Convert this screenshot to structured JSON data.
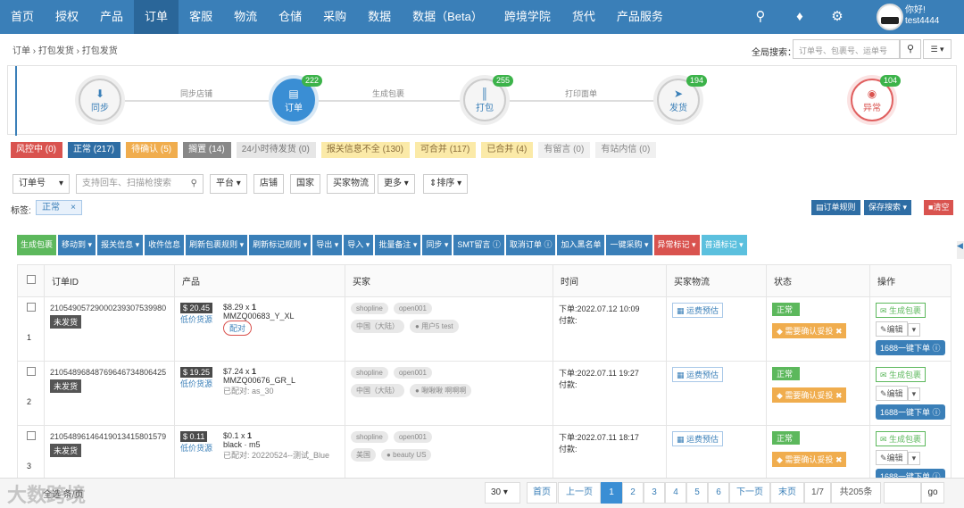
{
  "nav": {
    "items": [
      "首页",
      "授权",
      "产品",
      "订单",
      "客服",
      "物流",
      "仓储",
      "采购",
      "数据",
      "数据（Beta）",
      "跨境学院",
      "货代",
      "产品服务"
    ],
    "active": "订单",
    "user_greeting": "你好!",
    "username": "test4444"
  },
  "breadcrumb": [
    "订单",
    "打包发货",
    "打包发货"
  ],
  "global_search": {
    "label": "全局搜索：",
    "placeholder": "订单号、包裹号、运单号"
  },
  "steps": [
    {
      "label": "同步",
      "badge": ""
    },
    {
      "label": "订单",
      "badge": "222"
    },
    {
      "label": "打包",
      "badge": "255"
    },
    {
      "label": "发货",
      "badge": "194"
    },
    {
      "label": "异常",
      "badge": "104"
    }
  ],
  "step_arrows": [
    "同步店铺",
    "生成包裹",
    "打印面单"
  ],
  "filter_tags": [
    {
      "label": "风控中 (0)",
      "style": "red"
    },
    {
      "label": "正常 (217)",
      "style": "blue"
    },
    {
      "label": "待确认 (5)",
      "style": "orange"
    },
    {
      "label": "搁置 (14)",
      "style": "gray"
    },
    {
      "label": "24小时待发货 (0)",
      "style": "light"
    },
    {
      "label": "报关信息不全 (130)",
      "style": "yellow"
    },
    {
      "label": "可合并 (117)",
      "style": "yellow"
    },
    {
      "label": "已合并 (4)",
      "style": "yellow"
    },
    {
      "label": "有留言 (0)",
      "style": "lgray"
    },
    {
      "label": "有站内信 (0)",
      "style": "lgray"
    }
  ],
  "search": {
    "field": "订单号",
    "placeholder": "支持回车、扫描枪搜索",
    "filters": [
      "平台",
      "店铺",
      "国家",
      "买家物流",
      "更多",
      "排序"
    ]
  },
  "tag_row": {
    "label": "标签:",
    "chip": "正常"
  },
  "right_buttons": [
    "订单规则",
    "保存搜索",
    "清空"
  ],
  "toolbar": [
    "生成包裹",
    "移动到",
    "报关信息",
    "收件信息",
    "刷新包裹规则",
    "刷新标记规则",
    "导出",
    "导入",
    "批量备注",
    "同步",
    "SMT留言",
    "取消订单",
    "加入黑名单",
    "一键采购",
    "异常标记",
    "普通标记"
  ],
  "table": {
    "headers": [
      "订单ID",
      "产品",
      "买家",
      "时间",
      "买家物流",
      "状态",
      "操作"
    ],
    "rows": [
      {
        "index": "1",
        "order_id": "21054905729000239307539980",
        "tag": "未发货",
        "price": "$ 20.45",
        "cheap": "低价货源",
        "item_price": "$8.29",
        "qty": "1",
        "sku": "MMZQ00683_Y_XL",
        "match": "配对",
        "platform": "shopline",
        "store": "open001",
        "country": "中国（大陆）",
        "buyer": "用户5 test",
        "time": "下单:2022.07.12 10:09",
        "paid": "付款:",
        "ship": "运费预估",
        "status": "正常",
        "warn": "需要确认妥投",
        "ops": [
          "生成包裹",
          "编辑",
          "1688一键下单"
        ]
      },
      {
        "index": "2",
        "order_id": "21054896848769646734806425",
        "tag": "未发货",
        "price": "$ 19.25",
        "cheap": "低价货源",
        "item_price": "$7.24",
        "qty": "1",
        "sku": "MMZQ00676_GR_L",
        "match": "已配对: as_30",
        "platform": "shopline",
        "store": "open001",
        "country": "中国（大陆）",
        "buyer": "啾啾啾 啊啊啊",
        "time": "下单:2022.07.11 19:27",
        "paid": "付款:",
        "ship": "运费预估",
        "status": "正常",
        "warn": "需要确认妥投",
        "ops": [
          "生成包裹",
          "编辑",
          "1688一键下单"
        ]
      },
      {
        "index": "3",
        "order_id": "21054896146419013415801579",
        "tag": "未发货",
        "price": "$ 0.11",
        "cheap": "低价货源",
        "item_price": "$0.1",
        "qty": "1",
        "sku": "black · m5",
        "match": "已配对: 20220524--测试_Blue",
        "platform": "shopline",
        "store": "open001",
        "country": "美国",
        "buyer": "beauty US",
        "time": "下单:2022.07.11 18:17",
        "paid": "付款:",
        "ship": "运费预估",
        "status": "正常",
        "warn": "需要确认妥投",
        "ops": [
          "生成包裹",
          "编辑",
          "1688一键下单"
        ]
      }
    ]
  },
  "pager": {
    "select_all": "全选",
    "count_label": "条/页",
    "page_size": "30",
    "first": "首页",
    "prev": "上一页",
    "pages": [
      "1",
      "2",
      "3",
      "4",
      "5",
      "6"
    ],
    "next": "下一页",
    "last": "末页",
    "page_of": "1/7",
    "total": "共205条",
    "go": "go"
  },
  "watermark": "大数跨境"
}
